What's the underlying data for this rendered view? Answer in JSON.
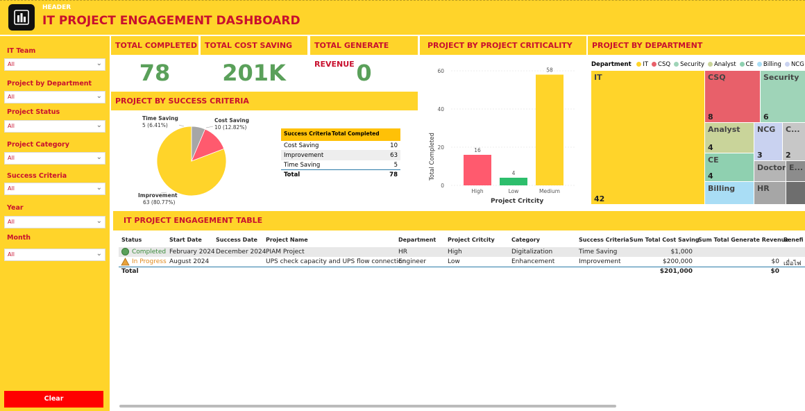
{
  "header": {
    "small": "HEADER",
    "title": "IT PROJECT ENGAGEMENT DASHBOARD"
  },
  "filters": [
    {
      "label": "IT Team",
      "value": "All"
    },
    {
      "label": "Project by Department",
      "value": "All"
    },
    {
      "label": "Project Status",
      "value": "All"
    },
    {
      "label": "Project Category",
      "value": "All"
    },
    {
      "label": "Success Criteria",
      "value": "All"
    },
    {
      "label": "Year",
      "value": "All"
    },
    {
      "label": "Month",
      "value": "All"
    }
  ],
  "clear_label": "Clear",
  "kpis": {
    "completed": {
      "label": "TOTAL COMPLETED",
      "value": "78"
    },
    "cost": {
      "label": "TOTAL COST SAVING",
      "value": "201K"
    },
    "revenue": {
      "label": "TOTAL GENERATE REVENUE",
      "value": "0"
    }
  },
  "success": {
    "title": "PROJECT BY SUCCESS CRITERIA",
    "pie": [
      {
        "name": "Improvement",
        "value": 63,
        "label": "63 (80.77%)",
        "color": "#FFD42A"
      },
      {
        "name": "Time Saving",
        "value": 5,
        "label": "5 (6.41%)",
        "color": "#A6A6A6"
      },
      {
        "name": "Cost Saving",
        "value": 10,
        "label": "10 (12.82%)",
        "color": "#FF5A6E"
      }
    ],
    "table": {
      "headers": [
        "Success Criteria",
        "Total Completed"
      ],
      "rows": [
        [
          "Cost Saving",
          "10"
        ],
        [
          "Improvement",
          "63"
        ],
        [
          "Time Saving",
          "5"
        ]
      ],
      "total": [
        "Total",
        "78"
      ]
    }
  },
  "criticality": {
    "title": "PROJECT BY PROJECT CRITICALITY",
    "xlabel": "Project Critcity",
    "ylabel": "Total Completed",
    "yticks": [
      "0",
      "20",
      "40",
      "60"
    ]
  },
  "chart_data": {
    "type": "bar",
    "categories": [
      "High",
      "Low",
      "Medium"
    ],
    "values": [
      16,
      4,
      58
    ],
    "colors": [
      "#FF5A6E",
      "#2DBE6C",
      "#FFD42A"
    ],
    "xlabel": "Project Critcity",
    "ylabel": "Total Completed",
    "ylim": [
      0,
      60
    ]
  },
  "department": {
    "title": "PROJECT BY DEPARTMENT",
    "legend_title": "Department",
    "legend": [
      {
        "name": "IT",
        "color": "#FFD42A"
      },
      {
        "name": "CSQ",
        "color": "#E8606A"
      },
      {
        "name": "Security",
        "color": "#9FD4B8"
      },
      {
        "name": "Analyst",
        "color": "#C9D49A"
      },
      {
        "name": "CE",
        "color": "#8FD0B0"
      },
      {
        "name": "Billing",
        "color": "#A9DDF5"
      },
      {
        "name": "NCG",
        "color": "#C9D2F0"
      }
    ],
    "tiles": [
      {
        "name": "IT",
        "value": "42"
      },
      {
        "name": "CSQ",
        "value": "8"
      },
      {
        "name": "Security",
        "value": "6"
      },
      {
        "name": "Analyst",
        "value": "4"
      },
      {
        "name": "NCG",
        "value": "3"
      },
      {
        "name": "C...",
        "value": "2"
      },
      {
        "name": "CE",
        "value": "4"
      },
      {
        "name": "Doctor",
        "value": ""
      },
      {
        "name": "E...",
        "value": ""
      },
      {
        "name": "Billing",
        "value": ""
      },
      {
        "name": "HR",
        "value": ""
      },
      {
        "name": "",
        "value": ""
      }
    ]
  },
  "eng_table": {
    "title": "IT PROJECT ENGAGEMENT TABLE",
    "headers": [
      "Status",
      "Start Date",
      "Success Date",
      "Project Name",
      "Department",
      "Project Critcity",
      "Category",
      "Success Criteria",
      "Sum Total Cost Saving",
      "Sum Total Generate Revenue",
      "Benefi"
    ],
    "rows": [
      [
        "Completed",
        "February 2024",
        "December 2024",
        "PIAM Project",
        "HR",
        "High",
        "Digitalization",
        "Time Saving",
        "$1,000",
        "",
        ""
      ],
      [
        "In Progress",
        "August 2024",
        "",
        "UPS check capacity and UPS flow connection",
        "Engineer",
        "Low",
        "Enhancement",
        "Improvement",
        "$200,000",
        "$0",
        "เมื่อไฟ"
      ]
    ],
    "total": [
      "Total",
      "$201,000",
      "$0"
    ]
  }
}
